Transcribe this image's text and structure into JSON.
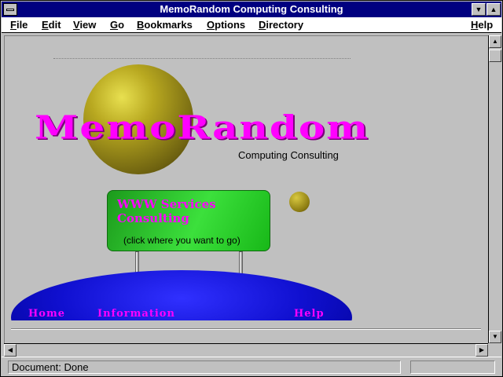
{
  "window": {
    "title": "MemoRandom Computing Consulting"
  },
  "menu": {
    "items": [
      {
        "label": "File"
      },
      {
        "label": "Edit"
      },
      {
        "label": "View"
      },
      {
        "label": "Go"
      },
      {
        "label": "Bookmarks"
      },
      {
        "label": "Options"
      },
      {
        "label": "Directory"
      },
      {
        "label": "Help"
      }
    ]
  },
  "page": {
    "logo_text": "MemoRandom",
    "tagline": "Computing Consulting",
    "sign": {
      "title": "WWW Services Consulting",
      "subtitle": "(click where you want to go)"
    },
    "links": [
      {
        "label": "Home"
      },
      {
        "label": "Information"
      },
      {
        "label": "Help"
      }
    ]
  },
  "status": {
    "text": "Document: Done",
    "progress": 0
  }
}
